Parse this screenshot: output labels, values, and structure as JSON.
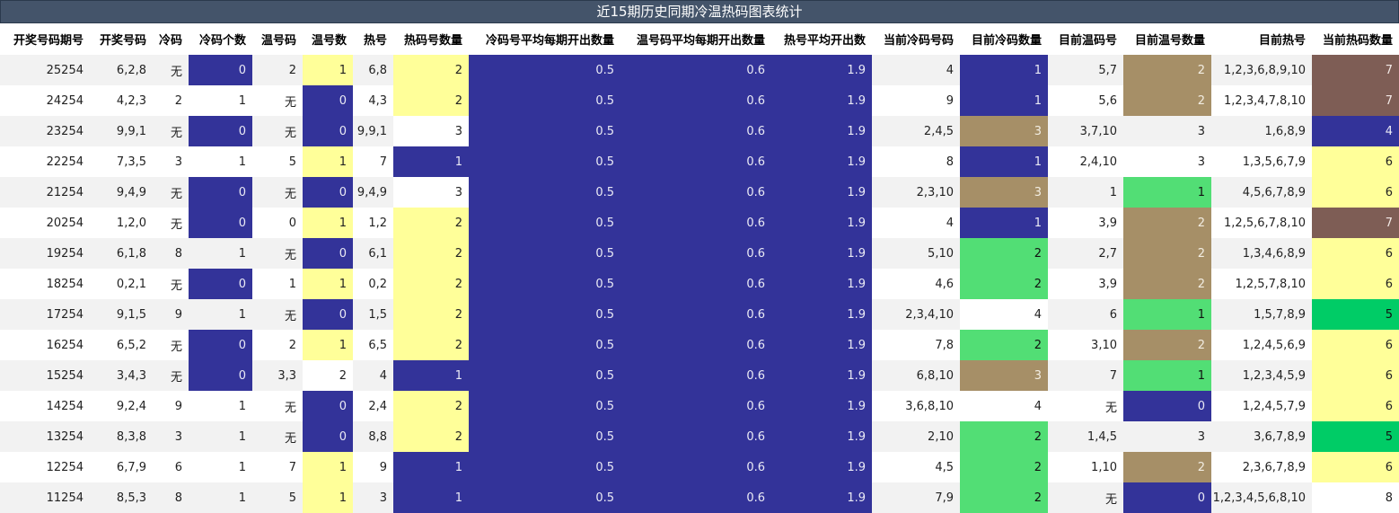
{
  "title": "近15期历史同期冷温热码图表统计",
  "headers": [
    "开奖号码期号",
    "开奖号码",
    "冷码",
    "冷码个数",
    "温号码",
    "温号数",
    "热号",
    "热码号数量",
    "冷码号平均每期开出数量",
    "温号码平均每期开出数量",
    "热号平均开出数",
    "当前冷码号码",
    "目前冷码数量",
    "目前温码号",
    "目前温号数量",
    "目前热号",
    "当前热码数量"
  ],
  "colors": {
    "blue": "#333399",
    "yellow": "#ffff99",
    "tan": "#a68f67",
    "light_green": "#52de75",
    "dark_green": "#00cc66",
    "brown": "#7e5d55",
    "title_bg": "#44546a",
    "stripe": "#f2f2f2"
  },
  "rows": [
    {
      "cells": [
        "25254",
        "6,2,8",
        "无",
        "0",
        "2",
        "1",
        "6,8",
        "2",
        "0.5",
        "0.6",
        "1.9",
        "4",
        "1",
        "5,7",
        "2",
        "1,2,3,6,8,9,10",
        "7"
      ],
      "fills": [
        "",
        "",
        "",
        "blue",
        "",
        "yellow",
        "",
        "yellow",
        "blue",
        "blue",
        "blue",
        "",
        "blue",
        "",
        "tan",
        "",
        "brown"
      ]
    },
    {
      "cells": [
        "24254",
        "4,2,3",
        "2",
        "1",
        "无",
        "0",
        "4,3",
        "2",
        "0.5",
        "0.6",
        "1.9",
        "9",
        "1",
        "5,6",
        "2",
        "1,2,3,4,7,8,10",
        "7"
      ],
      "fills": [
        "",
        "",
        "",
        "",
        "",
        "blue",
        "",
        "yellow",
        "blue",
        "blue",
        "blue",
        "",
        "blue",
        "",
        "tan",
        "",
        "brown"
      ]
    },
    {
      "cells": [
        "23254",
        "9,9,1",
        "无",
        "0",
        "无",
        "0",
        "9,9,1",
        "3",
        "0.5",
        "0.6",
        "1.9",
        "2,4,5",
        "3",
        "3,7,10",
        "3",
        "1,6,8,9",
        "4"
      ],
      "fills": [
        "",
        "",
        "",
        "blue",
        "",
        "blue",
        "",
        "white",
        "blue",
        "blue",
        "blue",
        "",
        "tan",
        "",
        "",
        "",
        "blue"
      ]
    },
    {
      "cells": [
        "22254",
        "7,3,5",
        "3",
        "1",
        "5",
        "1",
        "7",
        "1",
        "0.5",
        "0.6",
        "1.9",
        "8",
        "1",
        "2,4,10",
        "3",
        "1,3,5,6,7,9",
        "6"
      ],
      "fills": [
        "",
        "",
        "",
        "",
        "",
        "yellow",
        "",
        "blue",
        "blue",
        "blue",
        "blue",
        "",
        "blue",
        "",
        "",
        "",
        "yellow"
      ]
    },
    {
      "cells": [
        "21254",
        "9,4,9",
        "无",
        "0",
        "无",
        "0",
        "9,4,9",
        "3",
        "0.5",
        "0.6",
        "1.9",
        "2,3,10",
        "3",
        "1",
        "1",
        "4,5,6,7,8,9",
        "6"
      ],
      "fills": [
        "",
        "",
        "",
        "blue",
        "",
        "blue",
        "",
        "white",
        "blue",
        "blue",
        "blue",
        "",
        "tan",
        "",
        "light_green",
        "",
        "yellow"
      ]
    },
    {
      "cells": [
        "20254",
        "1,2,0",
        "无",
        "0",
        "0",
        "1",
        "1,2",
        "2",
        "0.5",
        "0.6",
        "1.9",
        "4",
        "1",
        "3,9",
        "2",
        "1,2,5,6,7,8,10",
        "7"
      ],
      "fills": [
        "",
        "",
        "",
        "blue",
        "",
        "yellow",
        "",
        "yellow",
        "blue",
        "blue",
        "blue",
        "",
        "blue",
        "",
        "tan",
        "",
        "brown"
      ]
    },
    {
      "cells": [
        "19254",
        "6,1,8",
        "8",
        "1",
        "无",
        "0",
        "6,1",
        "2",
        "0.5",
        "0.6",
        "1.9",
        "5,10",
        "2",
        "2,7",
        "2",
        "1,3,4,6,8,9",
        "6"
      ],
      "fills": [
        "",
        "",
        "",
        "",
        "",
        "blue",
        "",
        "yellow",
        "blue",
        "blue",
        "blue",
        "",
        "light_green",
        "",
        "tan",
        "",
        "yellow"
      ]
    },
    {
      "cells": [
        "18254",
        "0,2,1",
        "无",
        "0",
        "1",
        "1",
        "0,2",
        "2",
        "0.5",
        "0.6",
        "1.9",
        "4,6",
        "2",
        "3,9",
        "2",
        "1,2,5,7,8,10",
        "6"
      ],
      "fills": [
        "",
        "",
        "",
        "blue",
        "",
        "yellow",
        "",
        "yellow",
        "blue",
        "blue",
        "blue",
        "",
        "light_green",
        "",
        "tan",
        "",
        "yellow"
      ]
    },
    {
      "cells": [
        "17254",
        "9,1,5",
        "9",
        "1",
        "无",
        "0",
        "1,5",
        "2",
        "0.5",
        "0.6",
        "1.9",
        "2,3,4,10",
        "4",
        "6",
        "1",
        "1,5,7,8,9",
        "5"
      ],
      "fills": [
        "",
        "",
        "",
        "",
        "",
        "blue",
        "",
        "yellow",
        "blue",
        "blue",
        "blue",
        "",
        "white",
        "",
        "light_green",
        "",
        "dark_green"
      ]
    },
    {
      "cells": [
        "16254",
        "6,5,2",
        "无",
        "0",
        "2",
        "1",
        "6,5",
        "2",
        "0.5",
        "0.6",
        "1.9",
        "7,8",
        "2",
        "3,10",
        "2",
        "1,2,4,5,6,9",
        "6"
      ],
      "fills": [
        "",
        "",
        "",
        "blue",
        "",
        "yellow",
        "",
        "yellow",
        "blue",
        "blue",
        "blue",
        "",
        "light_green",
        "",
        "tan",
        "",
        "yellow"
      ]
    },
    {
      "cells": [
        "15254",
        "3,4,3",
        "无",
        "0",
        "3,3",
        "2",
        "4",
        "1",
        "0.5",
        "0.6",
        "1.9",
        "6,8,10",
        "3",
        "7",
        "1",
        "1,2,3,4,5,9",
        "6"
      ],
      "fills": [
        "",
        "",
        "",
        "blue",
        "",
        "white",
        "",
        "blue",
        "blue",
        "blue",
        "blue",
        "",
        "tan",
        "",
        "light_green",
        "",
        "yellow"
      ]
    },
    {
      "cells": [
        "14254",
        "9,2,4",
        "9",
        "1",
        "无",
        "0",
        "2,4",
        "2",
        "0.5",
        "0.6",
        "1.9",
        "3,6,8,10",
        "4",
        "无",
        "0",
        "1,2,4,5,7,9",
        "6"
      ],
      "fills": [
        "",
        "",
        "",
        "",
        "",
        "blue",
        "",
        "yellow",
        "blue",
        "blue",
        "blue",
        "",
        "white",
        "",
        "blue",
        "",
        "yellow"
      ]
    },
    {
      "cells": [
        "13254",
        "8,3,8",
        "3",
        "1",
        "无",
        "0",
        "8,8",
        "2",
        "0.5",
        "0.6",
        "1.9",
        "2,10",
        "2",
        "1,4,5",
        "3",
        "3,6,7,8,9",
        "5"
      ],
      "fills": [
        "",
        "",
        "",
        "",
        "",
        "blue",
        "",
        "yellow",
        "blue",
        "blue",
        "blue",
        "",
        "light_green",
        "",
        "",
        "",
        "dark_green"
      ]
    },
    {
      "cells": [
        "12254",
        "6,7,9",
        "6",
        "1",
        "7",
        "1",
        "9",
        "1",
        "0.5",
        "0.6",
        "1.9",
        "4,5",
        "2",
        "1,10",
        "2",
        "2,3,6,7,8,9",
        "6"
      ],
      "fills": [
        "",
        "",
        "",
        "",
        "",
        "yellow",
        "",
        "blue",
        "blue",
        "blue",
        "blue",
        "",
        "light_green",
        "",
        "tan",
        "",
        "yellow"
      ]
    },
    {
      "cells": [
        "11254",
        "8,5,3",
        "8",
        "1",
        "5",
        "1",
        "3",
        "1",
        "0.5",
        "0.6",
        "1.9",
        "7,9",
        "2",
        "无",
        "0",
        "1,2,3,4,5,6,8,10",
        "8"
      ],
      "fills": [
        "",
        "",
        "",
        "",
        "",
        "yellow",
        "",
        "blue",
        "blue",
        "blue",
        "blue",
        "",
        "light_green",
        "",
        "blue",
        "",
        "white"
      ]
    }
  ]
}
